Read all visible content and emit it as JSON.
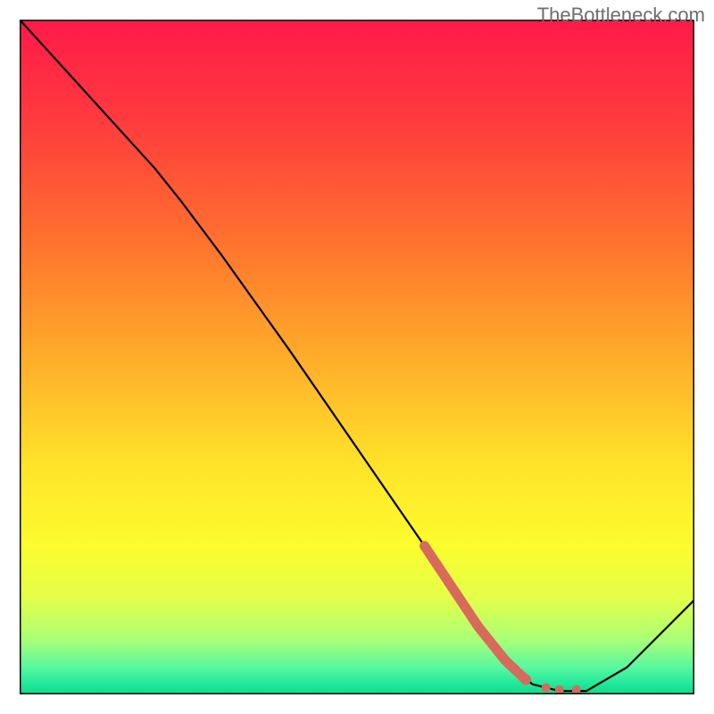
{
  "watermark": "TheBottleneck.com",
  "chart_data": {
    "type": "line",
    "title": "",
    "xlabel": "",
    "ylabel": "",
    "xlim": [
      0,
      100
    ],
    "ylim": [
      0,
      100
    ],
    "series": [
      {
        "name": "curve",
        "x": [
          0,
          10,
          20,
          24,
          30,
          40,
          50,
          60,
          68,
          72,
          76,
          80,
          84,
          90,
          100
        ],
        "y": [
          100,
          89,
          78,
          73,
          65,
          51,
          36.5,
          22,
          10,
          5,
          1.5,
          0.5,
          0.5,
          4,
          14
        ]
      }
    ],
    "highlight_segment": {
      "x": [
        60,
        68,
        72,
        75
      ],
      "y": [
        22,
        10,
        5,
        2.2
      ]
    },
    "highlight_dots": {
      "x": [
        75,
        78,
        80,
        82.5
      ],
      "y": [
        2.2,
        1.0,
        0.7,
        0.7
      ]
    },
    "gradient_stops": [
      {
        "offset": 0.0,
        "color": "#ff1a49"
      },
      {
        "offset": 0.15,
        "color": "#ff3b3e"
      },
      {
        "offset": 0.32,
        "color": "#ff6f2e"
      },
      {
        "offset": 0.5,
        "color": "#ffac2a"
      },
      {
        "offset": 0.66,
        "color": "#ffe329"
      },
      {
        "offset": 0.78,
        "color": "#fcfc2e"
      },
      {
        "offset": 0.86,
        "color": "#e1ff4a"
      },
      {
        "offset": 0.92,
        "color": "#a8ff78"
      },
      {
        "offset": 0.96,
        "color": "#58f7a0"
      },
      {
        "offset": 0.985,
        "color": "#20e89a"
      },
      {
        "offset": 1.0,
        "color": "#0fd98c"
      }
    ],
    "colors": {
      "curve": "#000000",
      "highlight": "#d86a5c",
      "border": "#000000"
    }
  }
}
